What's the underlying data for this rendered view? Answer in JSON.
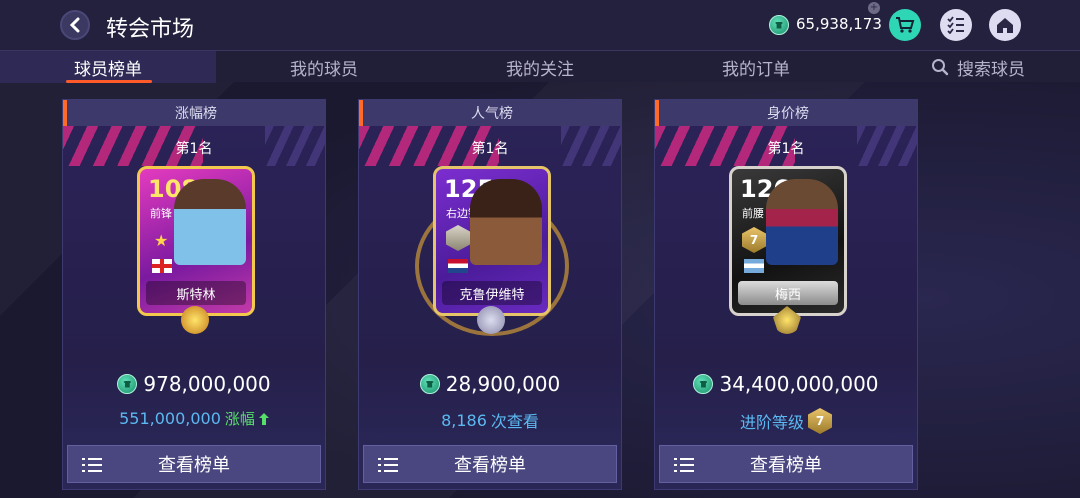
{
  "header": {
    "title": "转会市场",
    "balance": "65,938,173"
  },
  "tabs": [
    {
      "label": "球员榜单"
    },
    {
      "label": "我的球员"
    },
    {
      "label": "我的关注"
    },
    {
      "label": "我的订单"
    },
    {
      "label": "搜索球员"
    }
  ],
  "cards": [
    {
      "tab": "涨幅榜",
      "rank": "第1名",
      "rating": "108",
      "position": "前锋",
      "player": "斯特林",
      "price": "978,000,000",
      "sub_value": "551,000,000",
      "sub_label": "涨幅",
      "button": "查看榜单"
    },
    {
      "tab": "人气榜",
      "rank": "第1名",
      "rating": "125",
      "position": "右边锋",
      "player": "克鲁伊维特",
      "price": "28,900,000",
      "sub_value": "8,186",
      "sub_label": "次查看",
      "button": "查看榜单"
    },
    {
      "tab": "身价榜",
      "rank": "第1名",
      "rating": "126",
      "position": "前腰",
      "player": "梅西",
      "price": "34,400,000,000",
      "sub_label": "进阶等级",
      "badge": "7",
      "button": "查看榜单"
    }
  ],
  "colors": {
    "accent": "#ff5a2a",
    "coin": "#2fd6b6",
    "rise": "#56e06a",
    "info": "#5bb8f0"
  }
}
